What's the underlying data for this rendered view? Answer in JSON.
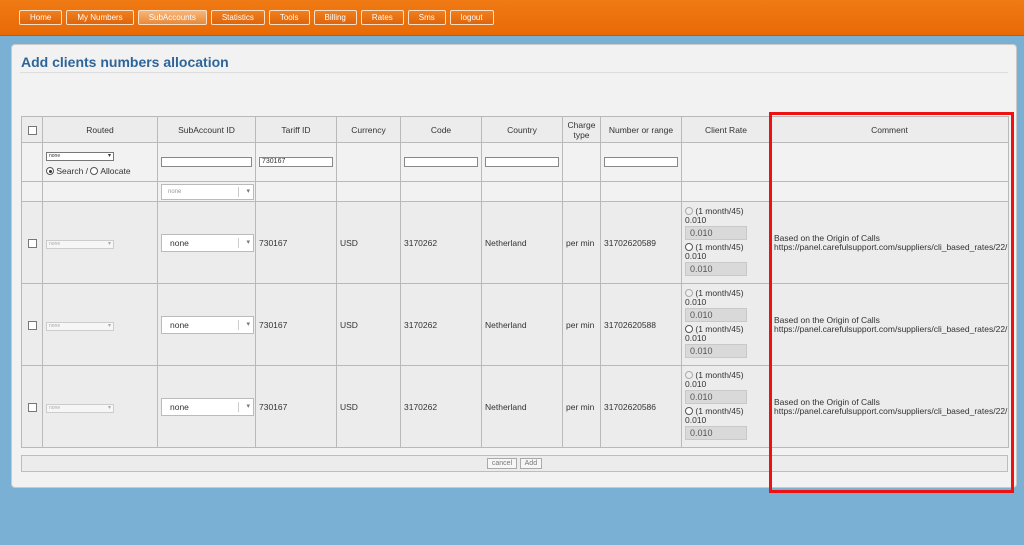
{
  "nav": {
    "items": [
      "Home",
      "My Numbers",
      "SubAccounts",
      "Statistics",
      "Tools",
      "Billing",
      "Rates",
      "Sms",
      "logout"
    ],
    "active_index": 2
  },
  "page": {
    "title": "Add clients numbers allocation"
  },
  "table": {
    "headers": {
      "routed": "Routed",
      "subaccount_id": "SubAccount ID",
      "tariff_id": "Tariff ID",
      "currency": "Currency",
      "code": "Code",
      "country": "Country",
      "charge_type": "Charge type",
      "number_or_range": "Number or range",
      "client_rate": "Client Rate",
      "comment": "Comment"
    },
    "filter": {
      "routed_select": "none",
      "search_label": "Search /",
      "allocate_label": "Allocate",
      "mode_selected": "search",
      "subaccount_value": "",
      "tariff_value": "730167",
      "code_value": "",
      "country_value": "",
      "number_value": "",
      "subaccount_select": "none"
    },
    "rows": [
      {
        "routed": "none",
        "subaccount": "none",
        "tariff_id": "730167",
        "currency": "USD",
        "code": "3170262",
        "country": "Netherland",
        "charge_type": "per min",
        "number": "31702620589",
        "rate_option_1": "(1 month/45)",
        "rate_value_1": "0.010",
        "rate_input_1": "0.010",
        "rate_option_2": "(1 month/45)",
        "rate_value_2": "0.010",
        "rate_input_2": "0.010",
        "comment_line_1": "Based on the Origin of Calls",
        "comment_line_2": "https://panel.carefulsupport.com/suppliers/cli_based_rates/22/"
      },
      {
        "routed": "none",
        "subaccount": "none",
        "tariff_id": "730167",
        "currency": "USD",
        "code": "3170262",
        "country": "Netherland",
        "charge_type": "per min",
        "number": "31702620588",
        "rate_option_1": "(1 month/45)",
        "rate_value_1": "0.010",
        "rate_input_1": "0.010",
        "rate_option_2": "(1 month/45)",
        "rate_value_2": "0.010",
        "rate_input_2": "0.010",
        "comment_line_1": "Based on the Origin of Calls",
        "comment_line_2": "https://panel.carefulsupport.com/suppliers/cli_based_rates/22/"
      },
      {
        "routed": "none",
        "subaccount": "none",
        "tariff_id": "730167",
        "currency": "USD",
        "code": "3170262",
        "country": "Netherland",
        "charge_type": "per min",
        "number": "31702620586",
        "rate_option_1": "(1 month/45)",
        "rate_value_1": "0.010",
        "rate_input_1": "0.010",
        "rate_option_2": "(1 month/45)",
        "rate_value_2": "0.010",
        "rate_input_2": "0.010",
        "comment_line_1": "Based on the Origin of Calls",
        "comment_line_2": "https://panel.carefulsupport.com/suppliers/cli_based_rates/22/"
      }
    ]
  },
  "footer": {
    "cancel_label": "cancel",
    "add_label": "Add"
  },
  "colors": {
    "topbar": "#ec6f0a",
    "title": "#2e6599",
    "highlight": "#ee1111",
    "background": "#7ab0d4"
  }
}
